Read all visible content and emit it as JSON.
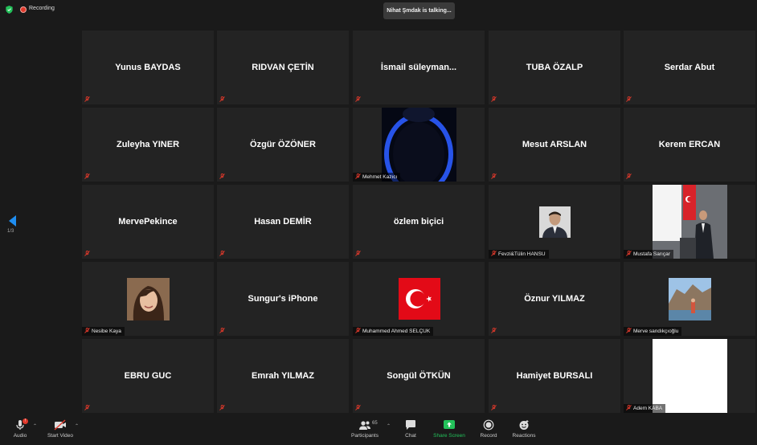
{
  "topbar": {
    "recording_label": "Recording",
    "talking_banner": "Nihat Şmdak is talking..."
  },
  "nav": {
    "page_indicator": "1/3"
  },
  "colors": {
    "accent": "#1f8ef1",
    "share_green": "#23c15a",
    "record_red": "#e0392b",
    "tile_bg": "#232323"
  },
  "tiles": [
    {
      "name": "Yunus BAYDAS"
    },
    {
      "name": "RIDVAN ÇETİN"
    },
    {
      "name": "İsmail  süleyman..."
    },
    {
      "name": "TUBA ÖZALP"
    },
    {
      "name": "Serdar Abut"
    },
    {
      "name": "Zuleyha YINER"
    },
    {
      "name": "Özgür ÖZÖNER"
    },
    {
      "label": "Mehmet Kazıcı"
    },
    {
      "name": "Mesut ARSLAN"
    },
    {
      "name": "Kerem ERCAN"
    },
    {
      "name": "MervePekince"
    },
    {
      "name": "Hasan DEMİR"
    },
    {
      "name": "özlem biçici"
    },
    {
      "label": "Fevzi&Tülin HANSU"
    },
    {
      "label": "Mustafa Sarıçar"
    },
    {
      "label": "Nesibe Kaya"
    },
    {
      "name": "Sungur's iPhone"
    },
    {
      "label": "Muhammed Ahmed SELÇUK"
    },
    {
      "name": "Öznur YILMAZ"
    },
    {
      "label": "Merve sandıkçıoğlu"
    },
    {
      "name": "EBRU GUC"
    },
    {
      "name": "Emrah YILMAZ"
    },
    {
      "name": "Songül ÖTKÜN"
    },
    {
      "name": "Hamiyet BURSALI"
    },
    {
      "label": "Adem KABA"
    }
  ],
  "toolbar": {
    "audio": "Audio",
    "start_video": "Start Video",
    "participants": "Participants",
    "participants_count": "65",
    "chat": "Chat",
    "share_screen": "Share Screen",
    "record": "Record",
    "reactions": "Reactions"
  }
}
